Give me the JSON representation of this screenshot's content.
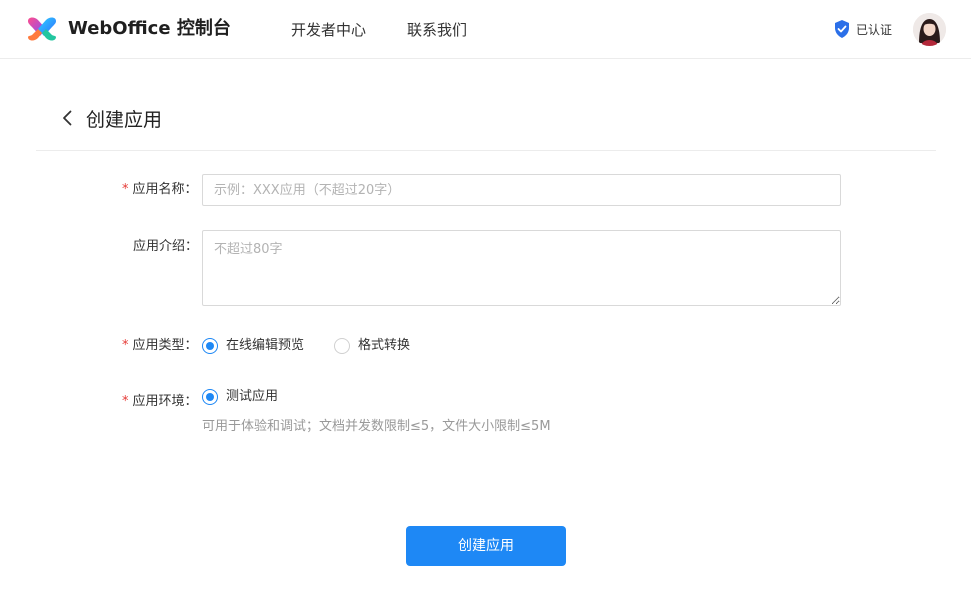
{
  "header": {
    "brand": "WebOffice 控制台",
    "nav": [
      {
        "label": "开发者中心"
      },
      {
        "label": "联系我们"
      }
    ],
    "verified_label": "已认证"
  },
  "page": {
    "title": "创建应用"
  },
  "form": {
    "required_mark": "*",
    "name": {
      "label": "应用名称：",
      "placeholder": "示例：XXX应用（不超过20字）",
      "value": ""
    },
    "intro": {
      "label": "应用介绍：",
      "placeholder": "不超过80字",
      "value": ""
    },
    "type": {
      "label": "应用类型：",
      "options": [
        {
          "label": "在线编辑预览",
          "checked": true
        },
        {
          "label": "格式转换",
          "checked": false
        }
      ]
    },
    "env": {
      "label": "应用环境：",
      "options": [
        {
          "label": "测试应用",
          "checked": true
        }
      ],
      "hint": "可用于体验和调试；文档并发数限制≤5，文件大小限制≤5M"
    },
    "submit_label": "创建应用"
  },
  "colors": {
    "accent": "#1e88f5",
    "required": "#e53935",
    "verified_badge": "#2b6fe8"
  }
}
